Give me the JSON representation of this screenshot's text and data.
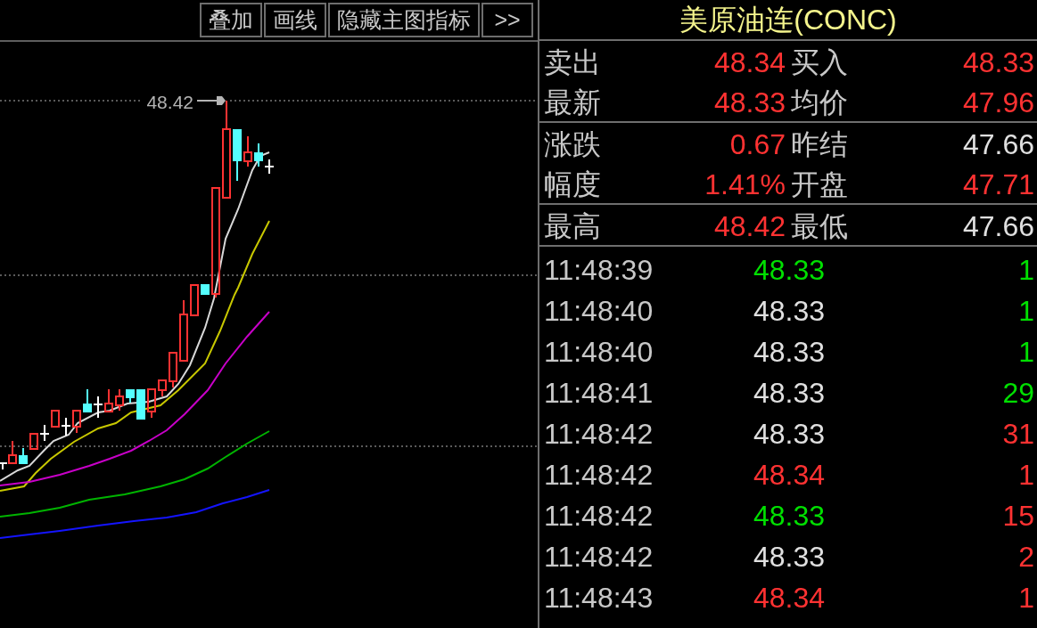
{
  "toolbar": {
    "buttons": [
      {
        "label": "叠加"
      },
      {
        "label": "画线"
      },
      {
        "label": "隐藏主图指标"
      },
      {
        "label": ">>"
      }
    ]
  },
  "chart": {
    "high_marker": "48.42"
  },
  "quote": {
    "title": "美原油连(CONC)",
    "groups": [
      {
        "rows": [
          {
            "cells": [
              {
                "label": "卖出",
                "value": "48.34",
                "color": "#ff3232"
              },
              {
                "label": "买入",
                "value": "48.33",
                "color": "#ff3232"
              }
            ]
          },
          {
            "cells": [
              {
                "label": "最新",
                "value": "48.33",
                "color": "#ff3232"
              },
              {
                "label": "均价",
                "value": "47.96",
                "color": "#ff3232"
              }
            ]
          }
        ]
      },
      {
        "rows": [
          {
            "cells": [
              {
                "label": "涨跌",
                "value": "0.67",
                "color": "#ff3232"
              },
              {
                "label": "昨结",
                "value": "47.66",
                "color": "#e0e0e0"
              }
            ]
          },
          {
            "cells": [
              {
                "label": "幅度",
                "value": "1.41%",
                "color": "#ff3232"
              },
              {
                "label": "开盘",
                "value": "47.71",
                "color": "#ff3232"
              }
            ]
          }
        ]
      },
      {
        "rows": [
          {
            "cells": [
              {
                "label": "最高",
                "value": "48.42",
                "color": "#ff3232"
              },
              {
                "label": "最低",
                "value": "47.66",
                "color": "#e0e0e0"
              }
            ]
          }
        ]
      }
    ]
  },
  "trades": [
    {
      "time": "11:48:39",
      "price": {
        "value": "48.33",
        "color": "#00e000"
      },
      "volume": {
        "value": "1",
        "color": "#00e000"
      }
    },
    {
      "time": "11:48:40",
      "price": {
        "value": "48.33",
        "color": "#e0e0e0"
      },
      "volume": {
        "value": "1",
        "color": "#00e000"
      }
    },
    {
      "time": "11:48:40",
      "price": {
        "value": "48.33",
        "color": "#e0e0e0"
      },
      "volume": {
        "value": "1",
        "color": "#00e000"
      }
    },
    {
      "time": "11:48:41",
      "price": {
        "value": "48.33",
        "color": "#e0e0e0"
      },
      "volume": {
        "value": "29",
        "color": "#00e000"
      }
    },
    {
      "time": "11:48:42",
      "price": {
        "value": "48.33",
        "color": "#e0e0e0"
      },
      "volume": {
        "value": "31",
        "color": "#ff3232"
      }
    },
    {
      "time": "11:48:42",
      "price": {
        "value": "48.34",
        "color": "#ff3232"
      },
      "volume": {
        "value": "1",
        "color": "#ff3232"
      }
    },
    {
      "time": "11:48:42",
      "price": {
        "value": "48.33",
        "color": "#00e000"
      },
      "volume": {
        "value": "15",
        "color": "#ff3232"
      }
    },
    {
      "time": "11:48:42",
      "price": {
        "value": "48.33",
        "color": "#e0e0e0"
      },
      "volume": {
        "value": "2",
        "color": "#ff3232"
      }
    },
    {
      "time": "11:48:43",
      "price": {
        "value": "48.34",
        "color": "#ff3232"
      },
      "volume": {
        "value": "1",
        "color": "#ff3232"
      }
    }
  ]
}
